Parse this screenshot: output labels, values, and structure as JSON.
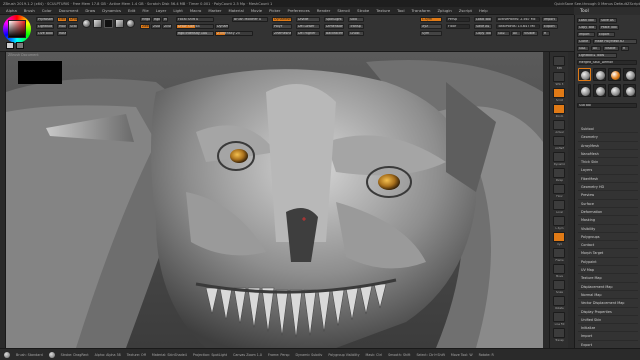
{
  "titlebar": {
    "left": "ZBrush 2019.1.2 (x64) · SCULPTURIS · Free Mem 17.8 GB · Active Mem 1.4 GB · Scratch Disk 56.4 MB · Timer 0.001 · PolyCount 2.5 Mp · MeshCount 1",
    "right": "QuickSave  See-through 0  Menus  DefaultZScript"
  },
  "menubar": {
    "items": [
      "Alpha",
      "Brush",
      "Color",
      "Document",
      "Draw",
      "Dynamics",
      "Edit",
      "File",
      "Layer",
      "Light",
      "Macro",
      "Marker",
      "Material",
      "Movie",
      "Picker",
      "Preferences",
      "Render",
      "Stencil",
      "Stroke",
      "Texture",
      "Tool",
      "Transform",
      "Zplugin",
      "Zscript",
      "Help"
    ]
  },
  "tool_header": "Tool",
  "shelf": {
    "buttons": {
      "projection": "PrjMaster",
      "lightbox": "LightBox",
      "live_boolean": "Live Boolean",
      "edit": "Edit",
      "draw": "Draw",
      "move": "Move",
      "scale": "Scale",
      "rotate": "Rotate",
      "mrgb": "Mrgb",
      "rgb": "Rgb",
      "m": "M",
      "zadd": "Zadd",
      "zsub": "Zsub",
      "zcut": "Zcut",
      "dynamesh": "DynaMesh",
      "polyf": "PolyF",
      "perspective": "Persp",
      "floor": "Floor",
      "local": "L.Sym",
      "xyz": "Xyz",
      "symmetry": "Sym",
      "back_face": "BackfaceMask",
      "zremesher": "ZRemesher",
      "solo": "Solo",
      "transp": "Transp",
      "ghost": "Ghost",
      "dimensions": "Dimensions",
      "spotlight": "SpotLight",
      "divide": "Divide",
      "smt": "Smt",
      "del_lower": "Del Lower",
      "del_higher": "Del Higher",
      "focal_shift": "Focal Shift 0",
      "draw_size": "Draw Size 64",
      "dynamic": "Dynamic",
      "rgb_intensity": "Rgb Intensity 100",
      "z_intensity": "Z Intensity 25",
      "brush_modifier": "Brush Modifier 0",
      "activepoints": "ActivePoints: 2.567 Mil",
      "totalpoints": "TotalPoints: 15.647 Mil",
      "load_tool": "Load Tool",
      "save_as": "Save As",
      "copy_tool": "Copy Tool",
      "paste_tool": "Paste Tool",
      "import": "Import",
      "export": "Export",
      "goz": "GoZ",
      "all": "All",
      "visible": "Visible",
      "r": "R"
    },
    "focal_shift_value": 0.0,
    "draw_size_value": 0.5,
    "z_intensity_value": 0.25,
    "rgb_intensity_value": 1.0
  },
  "canvas": {
    "doc_label": "ZBrush Document",
    "red_marker_color": "#e03030"
  },
  "vstrip": {
    "labels": [
      "BPR",
      "SPix 3",
      "Scroll",
      "Zoom",
      "Actual",
      "AAHalf",
      "Dynamic",
      "Persp",
      "Floor",
      "Local",
      "L.Sym",
      "Xyz",
      "Frame",
      "Move",
      "Scale",
      "Rotate",
      "Line Fill",
      "PolyF",
      "Transp",
      "Solo",
      "Xpose"
    ]
  },
  "panel": {
    "top_buttons": [
      "Load Tool",
      "Save As",
      "Copy Tool",
      "Paste Tool",
      "Import",
      "Export",
      "Clone",
      "Make PolyMesh3D",
      "GoZ",
      "All",
      "Visible",
      "R",
      "Lightbox ▸ Tools"
    ],
    "tool_name": "Merged_Skull_Demon",
    "subtools_header": "SubTool",
    "sub_items": [
      "Subtool",
      "Geometry",
      "ArrayMesh",
      "NanoMesh",
      "Thick Skin",
      "Layers",
      "FiberMesh",
      "Geometry HD",
      "Preview",
      "Surface",
      "Deformation",
      "Masking",
      "Visibility",
      "Polygroups",
      "Contact",
      "Morph Target",
      "Polypaint",
      "UV Map",
      "Texture Map",
      "Displacement Map",
      "Normal Map",
      "Vector Displacement Map",
      "Display Properties",
      "Unified Skin",
      "Initialize",
      "Import",
      "Export"
    ]
  },
  "bottombar": {
    "items": [
      "Brush: Standard",
      "Stroke: DragRect",
      "Alpha: Alpha 58",
      "Texture: Off",
      "Material: SkinShade4",
      "Projection: SpotLight",
      "Canvas Zoom 1.0",
      "Frame: Persp",
      "Dynamic Subdiv",
      "Polygroup Visibility",
      "Mask: Ctrl",
      "Smooth: Shift",
      "Select: Ctrl+Shift",
      "Move Tool: W",
      "Rotate: R"
    ]
  }
}
